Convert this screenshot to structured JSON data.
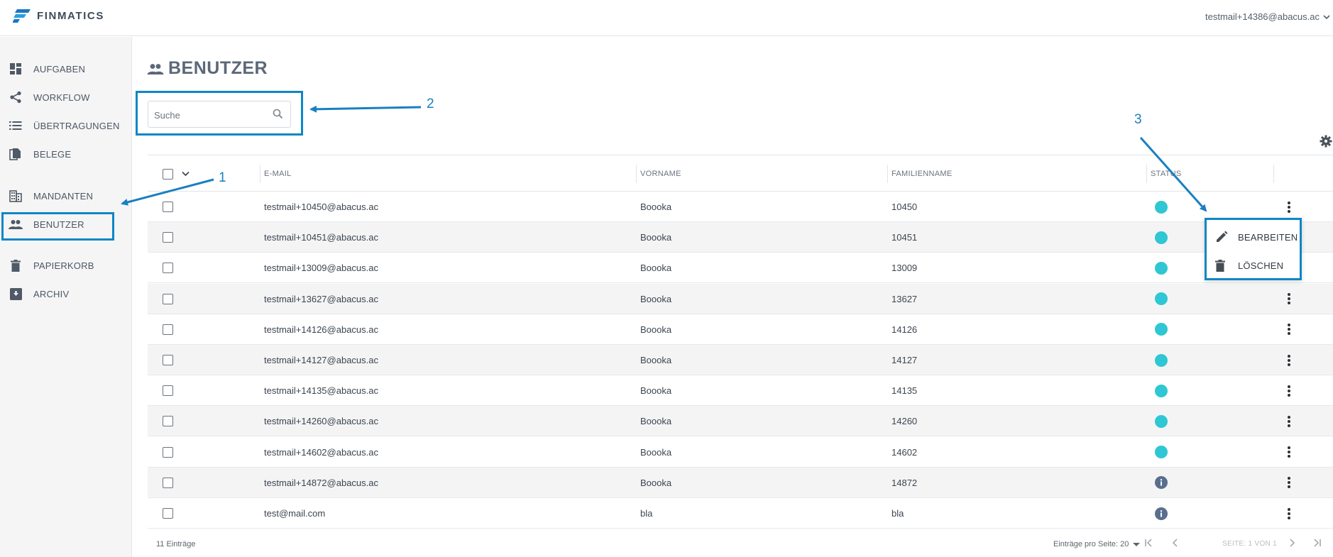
{
  "app": {
    "logo_text": "FINMATICS"
  },
  "header": {
    "user_email": "testmail+14386@abacus.ac"
  },
  "sidebar": {
    "items": [
      {
        "label": "AUFGABEN",
        "icon": "dashboard-icon"
      },
      {
        "label": "WORKFLOW",
        "icon": "share-icon"
      },
      {
        "label": "ÜBERTRAGUNGEN",
        "icon": "list-icon"
      },
      {
        "label": "BELEGE",
        "icon": "documents-icon"
      },
      {
        "label": "MANDANTEN",
        "icon": "building-icon"
      },
      {
        "label": "BENUTZER",
        "icon": "users-icon"
      },
      {
        "label": "PAPIERKORB",
        "icon": "trash-icon"
      },
      {
        "label": "ARCHIV",
        "icon": "archive-icon"
      }
    ]
  },
  "page": {
    "title": "BENUTZER"
  },
  "search": {
    "placeholder": "Suche"
  },
  "table": {
    "columns": [
      "E-MAIL",
      "VORNAME",
      "FAMILIENNAME",
      "STATUS"
    ],
    "rows": [
      {
        "email": "testmail+10450@abacus.ac",
        "vorname": "Boooka",
        "familienname": "10450",
        "status": "active"
      },
      {
        "email": "testmail+10451@abacus.ac",
        "vorname": "Boooka",
        "familienname": "10451",
        "status": "active"
      },
      {
        "email": "testmail+13009@abacus.ac",
        "vorname": "Boooka",
        "familienname": "13009",
        "status": "active"
      },
      {
        "email": "testmail+13627@abacus.ac",
        "vorname": "Boooka",
        "familienname": "13627",
        "status": "active"
      },
      {
        "email": "testmail+14126@abacus.ac",
        "vorname": "Boooka",
        "familienname": "14126",
        "status": "active"
      },
      {
        "email": "testmail+14127@abacus.ac",
        "vorname": "Boooka",
        "familienname": "14127",
        "status": "active"
      },
      {
        "email": "testmail+14135@abacus.ac",
        "vorname": "Boooka",
        "familienname": "14135",
        "status": "active"
      },
      {
        "email": "testmail+14260@abacus.ac",
        "vorname": "Boooka",
        "familienname": "14260",
        "status": "active"
      },
      {
        "email": "testmail+14602@abacus.ac",
        "vorname": "Boooka",
        "familienname": "14602",
        "status": "active"
      },
      {
        "email": "testmail+14872@abacus.ac",
        "vorname": "Boooka",
        "familienname": "14872",
        "status": "info"
      },
      {
        "email": "test@mail.com",
        "vorname": "bla",
        "familienname": "bla",
        "status": "info"
      }
    ]
  },
  "context_menu": {
    "items": [
      {
        "label": "BEARBEITEN",
        "icon": "pencil-icon"
      },
      {
        "label": "LÖSCHEN",
        "icon": "trash-icon"
      }
    ]
  },
  "footer": {
    "count": "11 Einträge",
    "per_page": "Einträge pro Seite: 20",
    "page_info": "SEITE: 1 VON 1"
  },
  "annotations": [
    "1",
    "2",
    "3"
  ],
  "colors": {
    "status_active": "#2ec7d3",
    "status_info": "#5a6f8e",
    "highlight": "#0f86c4",
    "brand": "#1b76c4"
  }
}
